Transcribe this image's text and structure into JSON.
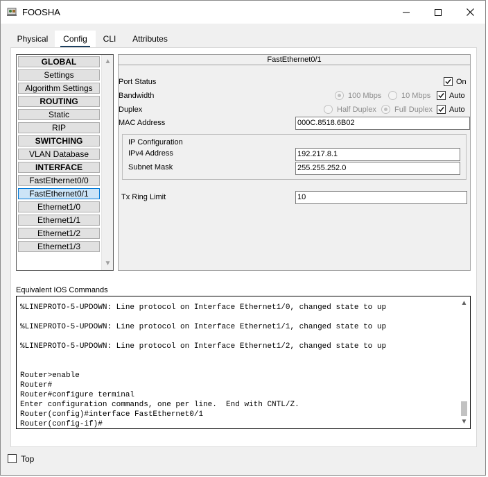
{
  "window": {
    "title": "FOOSHA",
    "controls": {
      "minimize": "minimize",
      "maximize": "maximize",
      "close": "close"
    }
  },
  "tabs": [
    {
      "label": "Physical",
      "active": false
    },
    {
      "label": "Config",
      "active": true
    },
    {
      "label": "CLI",
      "active": false
    },
    {
      "label": "Attributes",
      "active": false
    }
  ],
  "sidebar": {
    "items": [
      {
        "label": "GLOBAL",
        "type": "header"
      },
      {
        "label": "Settings",
        "type": "item"
      },
      {
        "label": "Algorithm Settings",
        "type": "item"
      },
      {
        "label": "ROUTING",
        "type": "header"
      },
      {
        "label": "Static",
        "type": "item"
      },
      {
        "label": "RIP",
        "type": "item"
      },
      {
        "label": "SWITCHING",
        "type": "header"
      },
      {
        "label": "VLAN Database",
        "type": "item"
      },
      {
        "label": "INTERFACE",
        "type": "header"
      },
      {
        "label": "FastEthernet0/0",
        "type": "item"
      },
      {
        "label": "FastEthernet0/1",
        "type": "item",
        "selected": true
      },
      {
        "label": "Ethernet1/0",
        "type": "item"
      },
      {
        "label": "Ethernet1/1",
        "type": "item"
      },
      {
        "label": "Ethernet1/2",
        "type": "item"
      },
      {
        "label": "Ethernet1/3",
        "type": "item"
      }
    ]
  },
  "panel": {
    "title": "FastEthernet0/1",
    "port_status": {
      "label": "Port Status",
      "on_label": "On",
      "checked": true
    },
    "bandwidth": {
      "label": "Bandwidth",
      "opt1": "100 Mbps",
      "opt2": "10 Mbps",
      "auto_label": "Auto",
      "auto_checked": true
    },
    "duplex": {
      "label": "Duplex",
      "opt1": "Half Duplex",
      "opt2": "Full Duplex",
      "auto_label": "Auto",
      "auto_checked": true
    },
    "mac": {
      "label": "MAC Address",
      "value": "000C.8518.6B02"
    },
    "ip_config": {
      "label": "IP Configuration",
      "ipv4_label": "IPv4 Address",
      "ipv4_value": "192.217.8.1",
      "mask_label": "Subnet Mask",
      "mask_value": "255.255.252.0"
    },
    "tx_ring": {
      "label": "Tx Ring Limit",
      "value": "10"
    }
  },
  "ios": {
    "label": "Equivalent IOS Commands",
    "lines": [
      "%LINEPROTO-5-UPDOWN: Line protocol on Interface Ethernet1/0, changed state to up",
      "",
      "%LINEPROTO-5-UPDOWN: Line protocol on Interface Ethernet1/1, changed state to up",
      "",
      "%LINEPROTO-5-UPDOWN: Line protocol on Interface Ethernet1/2, changed state to up",
      "",
      "",
      "Router>enable",
      "Router#",
      "Router#configure terminal",
      "Enter configuration commands, one per line.  End with CNTL/Z.",
      "Router(config)#interface FastEthernet0/1",
      "Router(config-if)#"
    ]
  },
  "footer": {
    "top_label": "Top",
    "top_checked": false
  }
}
